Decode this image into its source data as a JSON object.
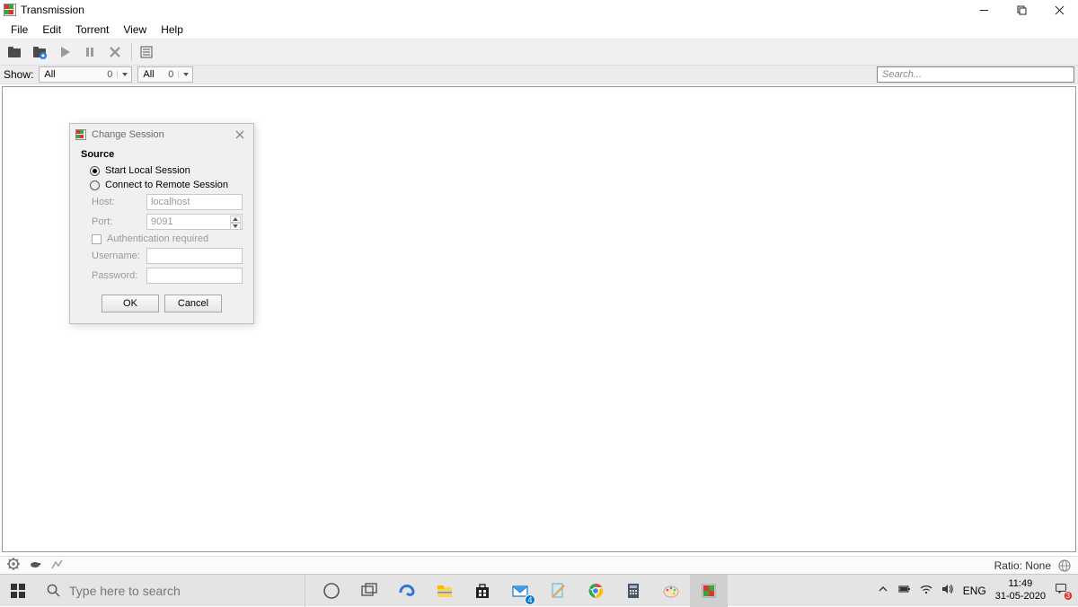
{
  "titlebar": {
    "title": "Transmission"
  },
  "menubar": {
    "items": [
      "File",
      "Edit",
      "Torrent",
      "View",
      "Help"
    ]
  },
  "filterbar": {
    "show_label": "Show:",
    "filter1": {
      "text": "All",
      "count": "0"
    },
    "filter2": {
      "text": "All",
      "count": "0"
    },
    "search_placeholder": "Search..."
  },
  "dialog": {
    "title": "Change Session",
    "section": "Source",
    "radio_local": "Start Local Session",
    "radio_remote": "Connect to Remote Session",
    "host_label": "Host:",
    "host_value": "localhost",
    "port_label": "Port:",
    "port_value": "9091",
    "auth_label": "Authentication required",
    "user_label": "Username:",
    "pass_label": "Password:",
    "ok": "OK",
    "cancel": "Cancel"
  },
  "statusbar": {
    "ratio": "Ratio: None"
  },
  "taskbar": {
    "search_placeholder": "Type here to search",
    "lang": "ENG",
    "time": "11:49",
    "date": "31-05-2020",
    "mail_badge": "4",
    "notif_badge": "3"
  }
}
